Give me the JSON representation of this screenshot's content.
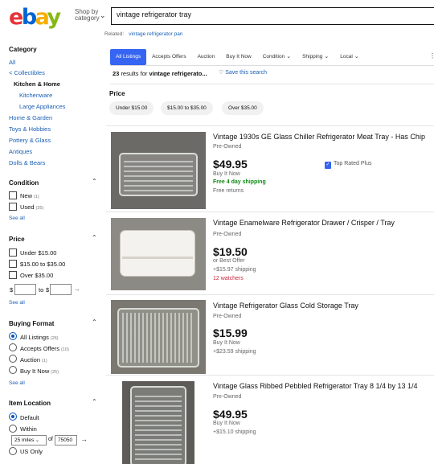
{
  "header": {
    "logo": "ebay",
    "shop_by_line1": "Shop by",
    "shop_by_line2": "category",
    "search_value": "vintage refrigerator tray"
  },
  "related": {
    "label": "Related:",
    "link": "vintage refrigerator pan"
  },
  "sidebar": {
    "category": {
      "title": "Category",
      "all": "All",
      "back": "< Collectibles",
      "current": "Kitchen & Home",
      "children": [
        "Kitchenware",
        "Large Appliances"
      ],
      "siblings": [
        "Home & Garden",
        "Toys & Hobbies",
        "Pottery & Glass",
        "Antiques",
        "Dolls & Bears"
      ]
    },
    "condition": {
      "title": "Condition",
      "options": [
        {
          "label": "New",
          "count": "(1)"
        },
        {
          "label": "Used",
          "count": "(25)"
        }
      ],
      "see_all": "See all"
    },
    "price": {
      "title": "Price",
      "options": [
        {
          "label": "Under $15.00"
        },
        {
          "label": "$15.00 to $35.00"
        },
        {
          "label": "Over $35.00"
        }
      ],
      "from_symbol": "$",
      "to_label": "to",
      "to_symbol": "$",
      "see_all": "See all"
    },
    "buying_format": {
      "title": "Buying Format",
      "options": [
        {
          "label": "All Listings",
          "count": "(26)",
          "selected": true
        },
        {
          "label": "Accepts Offers",
          "count": "(10)",
          "selected": false
        },
        {
          "label": "Auction",
          "count": "(1)",
          "selected": false
        },
        {
          "label": "Buy It Now",
          "count": "(25)",
          "selected": false
        }
      ],
      "see_all": "See all"
    },
    "item_location": {
      "title": "Item Location",
      "default": "Default",
      "within": "Within",
      "distance": "25 miles",
      "of_label": "of",
      "zip": "75050",
      "us_only": "US Only"
    }
  },
  "tabs": [
    {
      "label": "All Listings",
      "active": true
    },
    {
      "label": "Accepts Offers"
    },
    {
      "label": "Auction"
    },
    {
      "label": "Buy It Now"
    },
    {
      "label": "Condition",
      "dropdown": true
    },
    {
      "label": "Shipping",
      "dropdown": true
    },
    {
      "label": "Local",
      "dropdown": true
    }
  ],
  "results": {
    "count": "23",
    "text": "results for",
    "query": "vintage refrigerato...",
    "save_search": "Save this search"
  },
  "price_filter": {
    "title": "Price",
    "chips": [
      "Under $15.00",
      "$15.00 to $35.00",
      "Over $35.00"
    ]
  },
  "listings": [
    {
      "title": "Vintage 1930s GE Glass Chiller Refrigerator Meat Tray - Has Chip",
      "condition": "Pre-Owned",
      "price": "$49.95",
      "format": "Buy It Now",
      "shipping": "Free 4 day shipping",
      "returns": "Free returns",
      "badge": "Top Rated Plus"
    },
    {
      "title": "Vintage Enamelware Refrigerator Drawer / Crisper / Tray",
      "condition": "Pre-Owned",
      "price": "$19.50",
      "format": "or Best Offer",
      "shipping": "+$15.97 shipping",
      "watchers": "12 watchers"
    },
    {
      "title": "Vintage Refrigerator Glass Cold Storage Tray",
      "condition": "Pre-Owned",
      "price": "$15.99",
      "format": "Buy It Now",
      "shipping": "+$23.59 shipping"
    },
    {
      "title": "Vintage Glass Ribbed Pebbled Refrigerator Tray 8 1/4 by 13 1/4",
      "condition": "Pre-Owned",
      "price": "$49.95",
      "format": "Buy It Now",
      "shipping": "+$15.10 shipping"
    }
  ]
}
